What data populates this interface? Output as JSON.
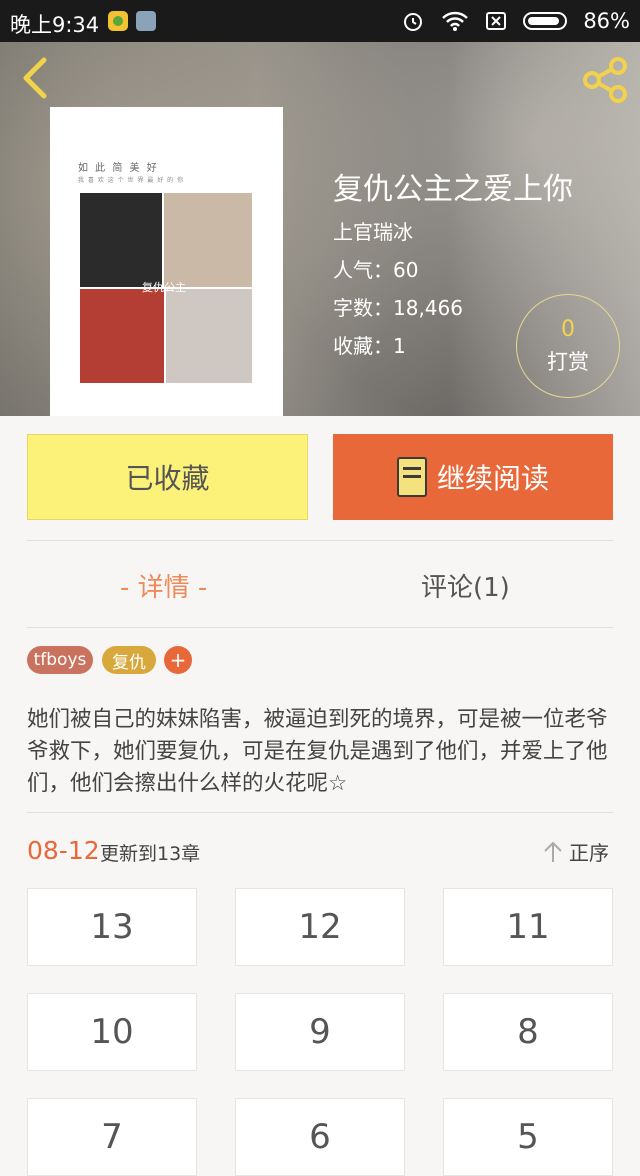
{
  "status_bar": {
    "time": "晚上9:34",
    "battery": "86%"
  },
  "book": {
    "title": "复仇公主之爱上你",
    "author": "上官瑞冰",
    "popularity": "人气：60",
    "word_count": "字数：18,466",
    "favorites": "收藏：1",
    "cover_watermark": "复仇公主"
  },
  "reward": {
    "count": "0",
    "label": "打赏"
  },
  "actions": {
    "favorited_label": "已收藏",
    "continue_label": "继续阅读"
  },
  "tabs": {
    "detail": "- 详情 -",
    "comments": "评论(1)"
  },
  "tags": [
    {
      "label": "tfboys",
      "color": "#c9735e"
    },
    {
      "label": "复仇",
      "color": "#d9a83c"
    },
    {
      "label": "+",
      "color": "#e8683a"
    }
  ],
  "description": "她们被自己的妹妹陷害，被逼迫到死的境界，可是被一位老爷爷救下，她们要复仇，可是在复仇是遇到了他们，并爱上了他们，他们会擦出什么样的火花呢☆",
  "update": {
    "date": "08-12",
    "text": "更新到13章",
    "sort_label": "正序"
  },
  "chapters": [
    "13",
    "12",
    "11",
    "10",
    "9",
    "8",
    "7",
    "6",
    "5"
  ]
}
